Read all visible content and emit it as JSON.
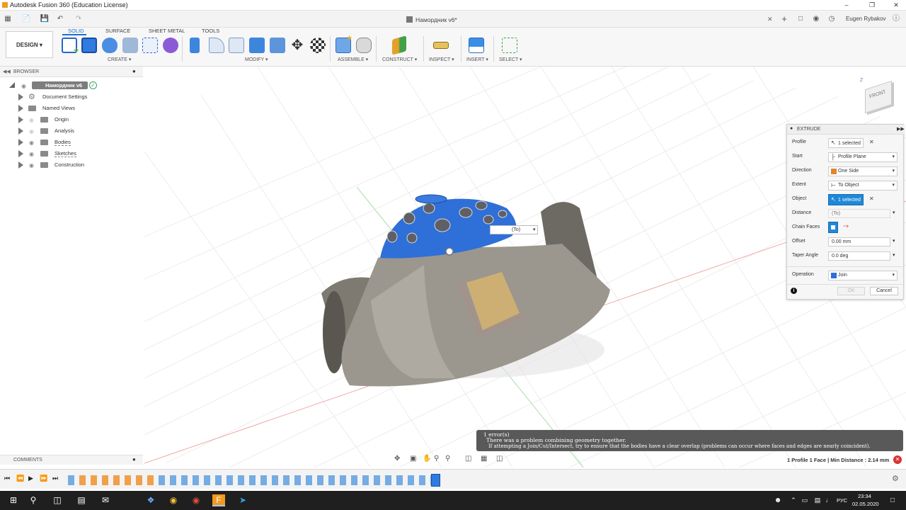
{
  "window": {
    "title": "Autodesk Fusion 360 (Education License)",
    "document_tab": "Намордник v6*",
    "user": "Eugen Rybakov"
  },
  "workspace": {
    "label": "DESIGN ▾"
  },
  "ribbon_tabs": [
    "SOLID",
    "SURFACE",
    "SHEET METAL",
    "TOOLS"
  ],
  "ribbon_groups": {
    "create": "CREATE ▾",
    "modify": "MODIFY ▾",
    "assemble": "ASSEMBLE ▾",
    "construct": "CONSTRUCT ▾",
    "inspect": "INSPECT ▾",
    "insert": "INSERT ▾",
    "select": "SELECT ▾"
  },
  "browser": {
    "title": "BROWSER",
    "root": "Намордник v6",
    "items": [
      "Document Settings",
      "Named Views",
      "Origin",
      "Analysis",
      "Bodies",
      "Sketches",
      "Construction"
    ]
  },
  "viewcube": {
    "label": "FRONT",
    "axis": "Z"
  },
  "canvas": {
    "distance_input": "(To)",
    "colors": {
      "selected_face": "#2f6fd8",
      "body": "#8e8a80",
      "background": "#ffffff",
      "grid": "#e6e6e6"
    }
  },
  "extrude": {
    "title": "EXTRUDE",
    "profile": {
      "label": "Profile",
      "value": "1 selected"
    },
    "start": {
      "label": "Start",
      "value": "Profile Plane"
    },
    "direction": {
      "label": "Direction",
      "value": "One Side"
    },
    "extent": {
      "label": "Extent",
      "value": "To Object"
    },
    "object": {
      "label": "Object",
      "value": "1 selected"
    },
    "distance": {
      "label": "Distance",
      "value": "(To)"
    },
    "chain_faces": {
      "label": "Chain Faces"
    },
    "offset": {
      "label": "Offset",
      "value": "0.00 mm"
    },
    "taper": {
      "label": "Taper Angle",
      "value": "0.0 deg"
    },
    "operation": {
      "label": "Operation",
      "value": "Join"
    },
    "ok": "OK",
    "cancel": "Cancel"
  },
  "comments": {
    "title": "COMMENTS"
  },
  "error": {
    "title": "1 error(s)",
    "line1": "There was a problem combining geometry together.",
    "line2": "If attempting a Join/Cut/Intersect, try to ensure that the bodies have a clear overlap (problems can occur where faces and edges are nearly coincident)."
  },
  "status": {
    "selection": "1 Profile 1 Face | Min Distance : 2.14 mm"
  },
  "taskbar": {
    "lang": "РУС",
    "time": "23:34",
    "date": "02.05.2020"
  }
}
